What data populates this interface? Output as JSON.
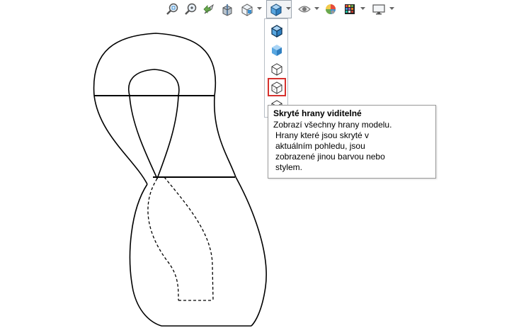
{
  "toolbar": {
    "buttons": [
      {
        "id": "zoom-to-fit",
        "icon": "zoom-fit-icon"
      },
      {
        "id": "zoom-to-area",
        "icon": "zoom-area-icon"
      },
      {
        "id": "previous-view",
        "icon": "previous-view-icon"
      },
      {
        "id": "section-view",
        "icon": "section-view-icon"
      },
      {
        "id": "view-orientation",
        "icon": "view-orientation-icon"
      },
      {
        "id": "display-style",
        "icon": "display-style-icon"
      },
      {
        "id": "hide-show-items",
        "icon": "eye-icon"
      },
      {
        "id": "edit-appearance",
        "icon": "appearance-icon"
      },
      {
        "id": "apply-scene",
        "icon": "scene-icon"
      },
      {
        "id": "view-settings",
        "icon": "monitor-icon"
      }
    ]
  },
  "display_style_menu": {
    "items": [
      {
        "id": "shaded-with-edges",
        "icon": "shaded-with-edges-icon"
      },
      {
        "id": "shaded",
        "icon": "shaded-icon"
      },
      {
        "id": "hidden-lines-removed",
        "icon": "hidden-lines-removed-icon"
      },
      {
        "id": "hidden-lines-visible",
        "icon": "hidden-lines-visible-icon",
        "selected": true
      },
      {
        "id": "wireframe",
        "icon": "wireframe-icon"
      }
    ]
  },
  "tooltip": {
    "title": "Skryté hrany viditelné",
    "lines": [
      "Zobrazí všechny hrany modelu.",
      "Hrany které jsou skryté v",
      "aktuálním pohledu, jsou",
      "zobrazené jinou barvou nebo",
      "stylem."
    ]
  },
  "colors": {
    "highlight_border": "#d6322e",
    "icon_blue": "#3a8fd0",
    "edge_color": "#000000"
  }
}
